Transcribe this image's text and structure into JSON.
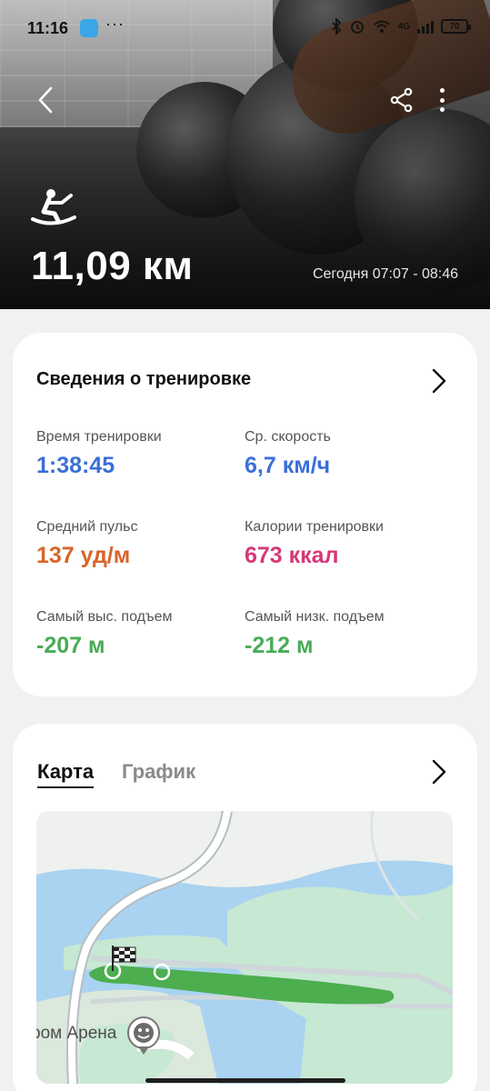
{
  "status_bar": {
    "time": "11:16",
    "dots": "···",
    "network": "4G",
    "battery": "70"
  },
  "header": {
    "distance": "11,09 км",
    "session_time": "Сегодня 07:07 - 08:46",
    "sport_icon": "rowing-icon",
    "colors": {
      "text": "#ffffff"
    }
  },
  "workout_info": {
    "title": "Сведения о тренировке",
    "stats": [
      {
        "label": "Время тренировки",
        "value": "1:38:45",
        "color": "#3b6fd8"
      },
      {
        "label": "Ср. скорость",
        "value": "6,7 км/ч",
        "color": "#3b6fd8"
      },
      {
        "label": "Средний пульс",
        "value": "137 уд/м",
        "color": "#d9642a"
      },
      {
        "label": "Калории тренировки",
        "value": "673 ккал",
        "color": "#d63878"
      },
      {
        "label": "Самый выс. подъем",
        "value": "-207 м",
        "color": "#49ac55"
      },
      {
        "label": "Самый низк. подъем",
        "value": "-212 м",
        "color": "#49ac55"
      }
    ]
  },
  "map_card": {
    "tabs": [
      {
        "label": "Карта",
        "active": true
      },
      {
        "label": "График",
        "active": false
      }
    ],
    "map_label": "ром Арена",
    "route_color": "#4cae4f"
  }
}
